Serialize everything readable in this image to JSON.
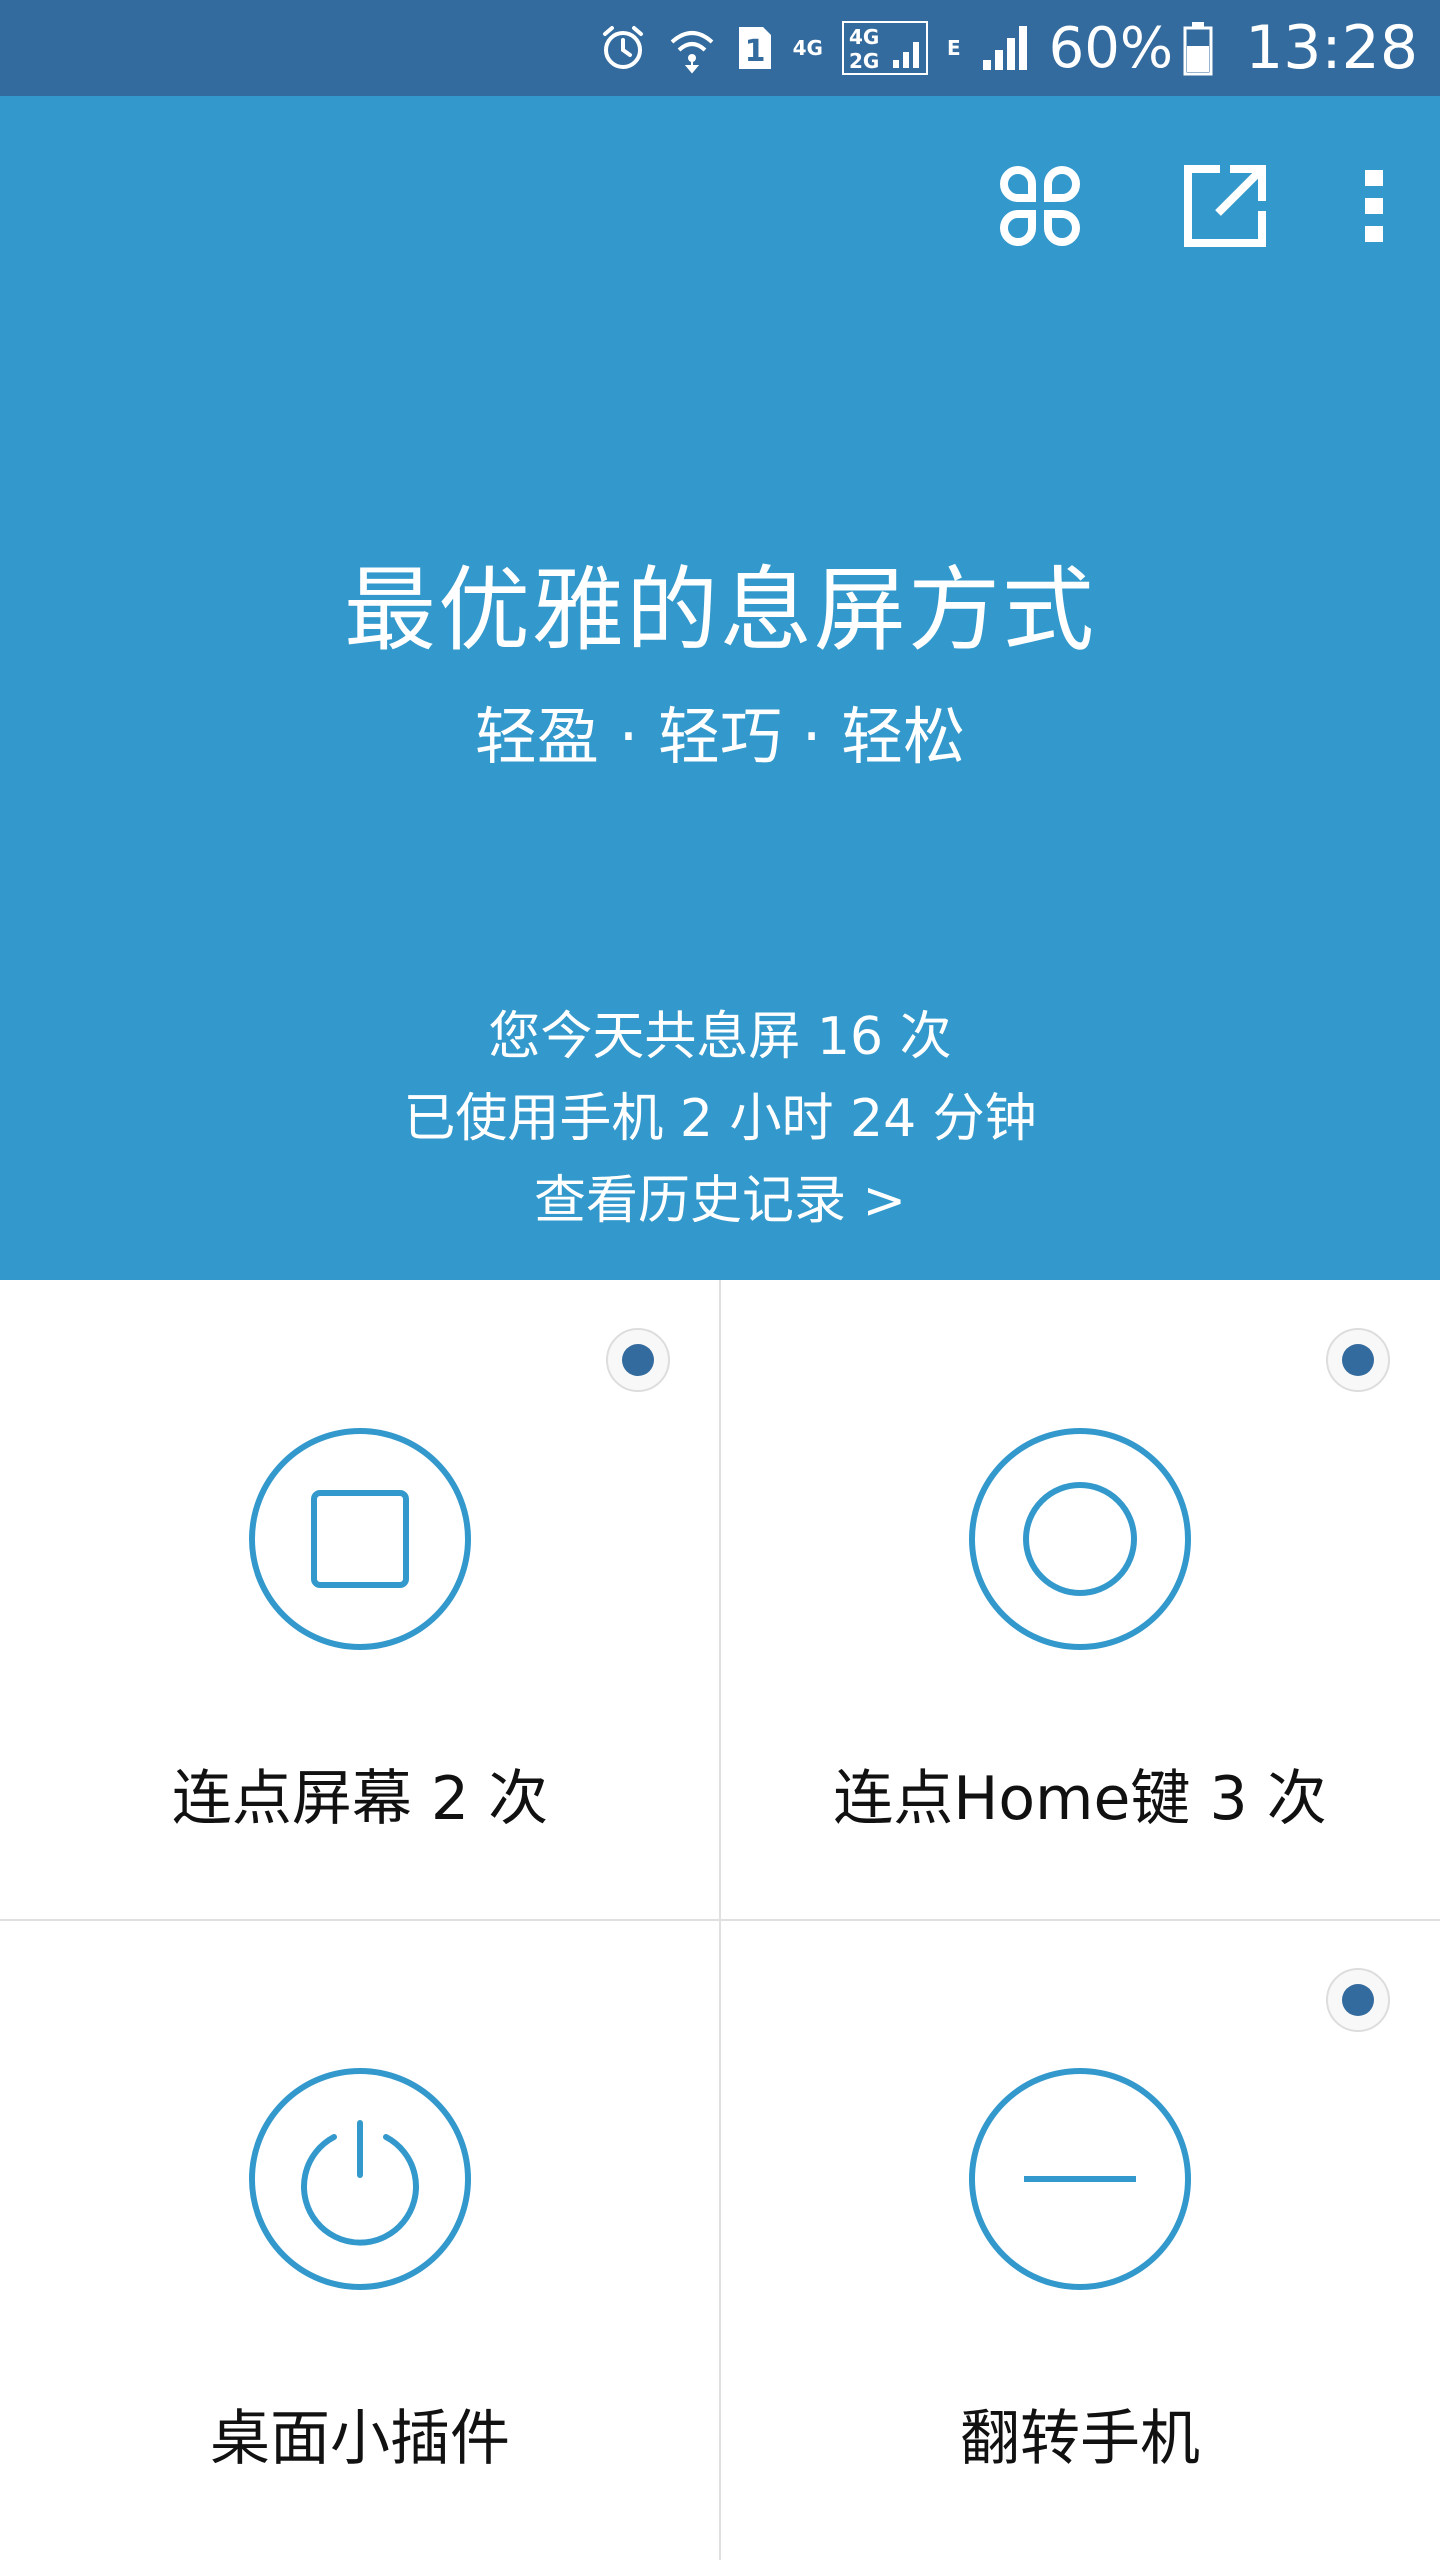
{
  "colors": {
    "status_bar": "#336b9e",
    "header": "#3399cc",
    "accent": "#3399cc",
    "radio_dot": "#336b9e"
  },
  "status_bar": {
    "icons": [
      "alarm-icon",
      "wifi-icon",
      "sim-1-icon",
      "4g-icon",
      "signal-4g-2g-icon",
      "e-icon",
      "signal-icon",
      "battery-icon"
    ],
    "network_4g": "4G",
    "network_4g2g_top": "4G",
    "network_4g2g_bottom": "2G",
    "sim_slot": "1",
    "network_e": "E",
    "battery": "60%",
    "time": "13:28"
  },
  "header": {
    "actions": [
      "apps-grid-icon",
      "share-external-icon",
      "more-vert-icon"
    ],
    "title": "最优雅的息屏方式",
    "subtitle": "轻盈 · 轻巧 · 轻松",
    "stats_line1": "您今天共息屏 16 次",
    "stats_line2": "已使用手机 2 小时 24 分钟",
    "history_link": "查看历史记录 >"
  },
  "methods": [
    {
      "label": "连点屏幕 2 次",
      "icon": "square-in-circle-icon",
      "selected": true
    },
    {
      "label": "连点Home键 3 次",
      "icon": "circle-in-circle-icon",
      "selected": true
    },
    {
      "label": "桌面小插件",
      "icon": "power-icon",
      "selected": false
    },
    {
      "label": "翻转手机",
      "icon": "minus-in-circle-icon",
      "selected": true
    }
  ]
}
